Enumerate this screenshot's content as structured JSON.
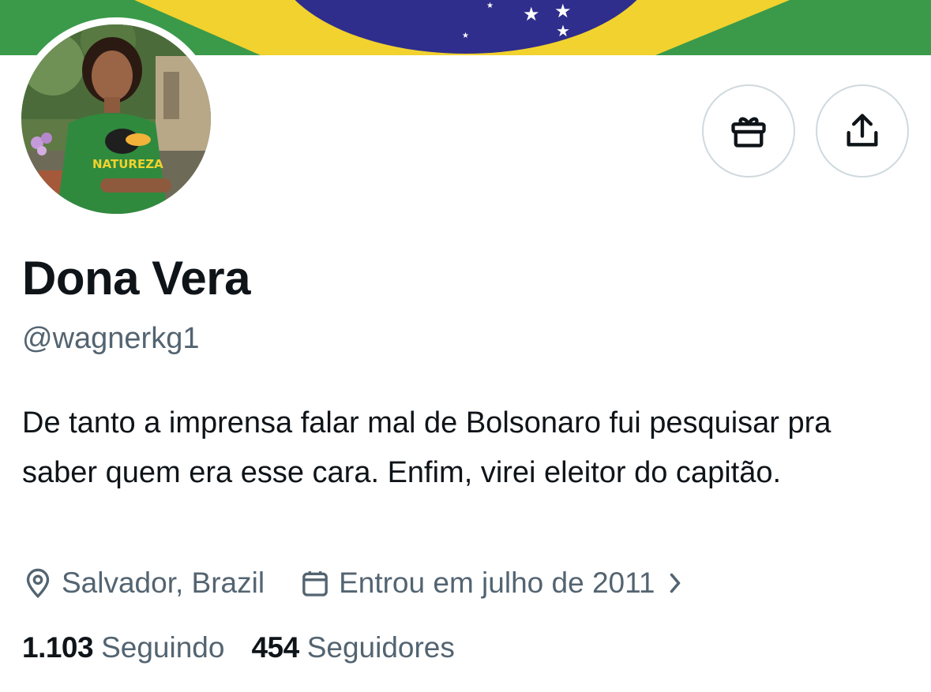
{
  "banner": {
    "image": "brazil-flag-banner",
    "colors": {
      "green": "#3a9a4a",
      "yellow": "#f2d22e",
      "blue": "#2f2e8c"
    }
  },
  "profile": {
    "avatar_image": "profile-photo-woman-green-natureza-shirt",
    "avatar_shirt_text": "NATUREZA",
    "name": "Dona Vera",
    "handle": "@wagnerkg1",
    "bio": "De tanto a imprensa falar mal de Bolsonaro fui pesquisar pra saber quem era esse cara. Enfim, virei eleitor do capitão.",
    "location": "Salvador, Brazil",
    "joined": "Entrou em julho de 2011"
  },
  "actions": {
    "gift_icon": "gift-icon",
    "share_icon": "share-icon"
  },
  "stats": {
    "following_count": "1.103",
    "following_label": "Seguindo",
    "followers_count": "454",
    "followers_label": "Seguidores"
  },
  "icons": {
    "location": "location-pin-icon",
    "calendar": "calendar-icon",
    "chevron": "chevron-right-icon"
  },
  "colors": {
    "text": "#0f1419",
    "secondary": "#536471",
    "border": "#cfd9de"
  }
}
